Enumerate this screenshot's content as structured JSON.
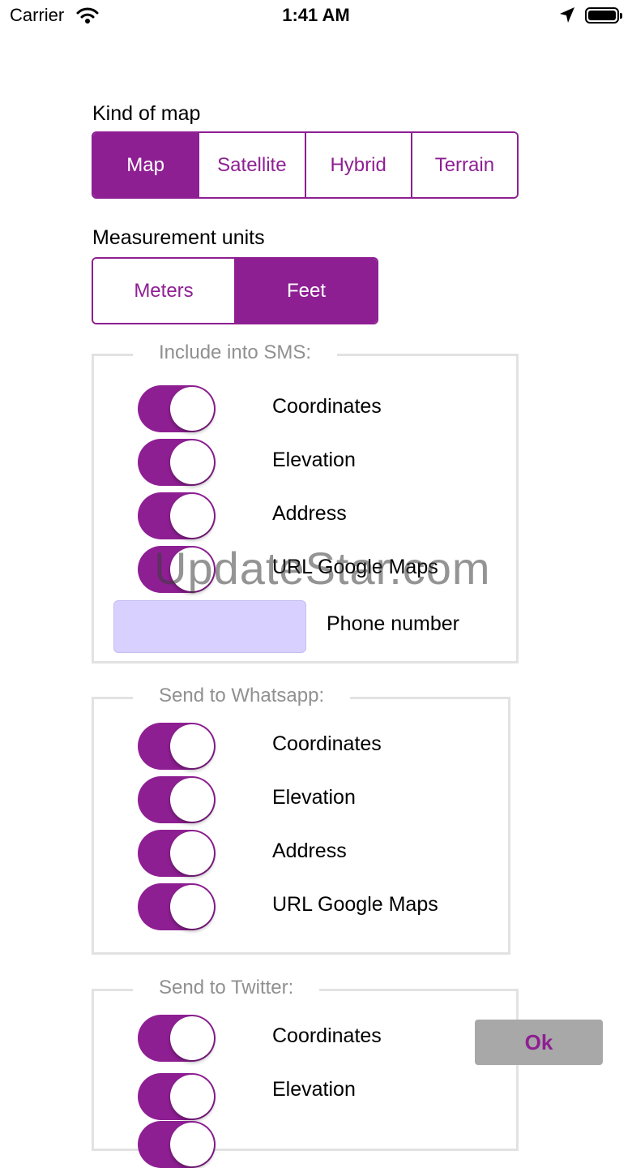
{
  "status_bar": {
    "carrier": "Carrier",
    "time": "1:41 AM"
  },
  "map_kind": {
    "label": "Kind of map",
    "options": [
      "Map",
      "Satellite",
      "Hybrid",
      "Terrain"
    ],
    "selected": "Map"
  },
  "units": {
    "label": "Measurement units",
    "options": [
      "Meters",
      "Feet"
    ],
    "selected": "Feet"
  },
  "sms": {
    "legend": "Include into SMS:",
    "toggles": [
      {
        "label": "Coordinates",
        "on": true
      },
      {
        "label": "Elevation",
        "on": true
      },
      {
        "label": "Address",
        "on": true
      },
      {
        "label": "URL Google Maps",
        "on": true
      }
    ],
    "phone": {
      "label": "Phone number",
      "value": ""
    }
  },
  "whatsapp": {
    "legend": "Send to Whatsapp:",
    "toggles": [
      {
        "label": "Coordinates",
        "on": true
      },
      {
        "label": "Elevation",
        "on": true
      },
      {
        "label": "Address",
        "on": true
      },
      {
        "label": "URL Google Maps",
        "on": true
      }
    ]
  },
  "twitter": {
    "legend": "Send to Twitter:",
    "toggles": [
      {
        "label": "Coordinates",
        "on": true
      },
      {
        "label": "Elevation",
        "on": true
      }
    ]
  },
  "ok_button": {
    "label": "Ok"
  },
  "watermark": "UpdateStar.com",
  "colors": {
    "accent": "#8e1f93",
    "phone_field": "#d8d0ff",
    "group_border": "#e2e2e2",
    "ok_bg": "#a8a8a8"
  },
  "icons": [
    "wifi-icon",
    "location-arrow-icon",
    "battery-icon"
  ]
}
